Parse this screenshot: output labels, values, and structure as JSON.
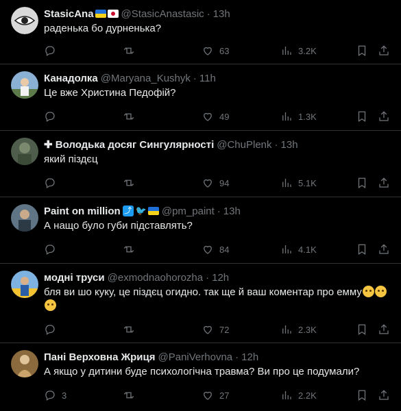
{
  "tweets": [
    {
      "name": "StasicAna",
      "handle": "@StasicAnastasic",
      "time": "13h",
      "text": "раденька бо дурненька?",
      "replies": "",
      "likes": "63",
      "views": "3.2K",
      "avatar_color": "#cfcfcf"
    },
    {
      "name": "Канадолка",
      "handle": "@Maryana_Kushyk",
      "time": "11h",
      "text": "Це вже Христина Педофій?",
      "replies": "",
      "likes": "49",
      "views": "1.3K",
      "avatar_color": "#7da3c7"
    },
    {
      "name": "✚ Володька досяг Сингулярності",
      "handle": "@ChuPlenk",
      "time": "13h",
      "text": "який піздєц",
      "replies": "",
      "likes": "94",
      "views": "5.1K",
      "avatar_color": "#556b57"
    },
    {
      "name": "Paint on million",
      "handle": "@pm_paint",
      "time": "13h",
      "text": "А нащо було губи підставлять?",
      "replies": "",
      "likes": "84",
      "views": "4.1K",
      "avatar_color": "#6c7f90"
    },
    {
      "name": "модні труси",
      "handle": "@exmodnaohorozha",
      "time": "12h",
      "text": "бля ви шо куку, це піздєц огидно. так ще й ваш коментар про емму",
      "replies": "",
      "likes": "72",
      "views": "2.3K",
      "avatar_color": "#6aa0d8"
    },
    {
      "name": "Пані Верховна Жриця",
      "handle": "@PaniVerhovna",
      "time": "12h",
      "text": "А якщо у дитини буде психологічна травма? Ви про це подумали?",
      "replies": "3",
      "likes": "27",
      "views": "2.2K",
      "avatar_color": "#b08a5a"
    }
  ],
  "colors": {
    "background": "#000000",
    "text": "#e7e9ea",
    "muted": "#71767b",
    "divider": "#2f3336"
  },
  "icons": [
    "reply-icon",
    "retweet-icon",
    "like-icon",
    "views-icon",
    "bookmark-icon",
    "share-icon",
    "ukraine-flag-icon",
    "japan-flag-icon",
    "emoji-pleading-icon"
  ]
}
